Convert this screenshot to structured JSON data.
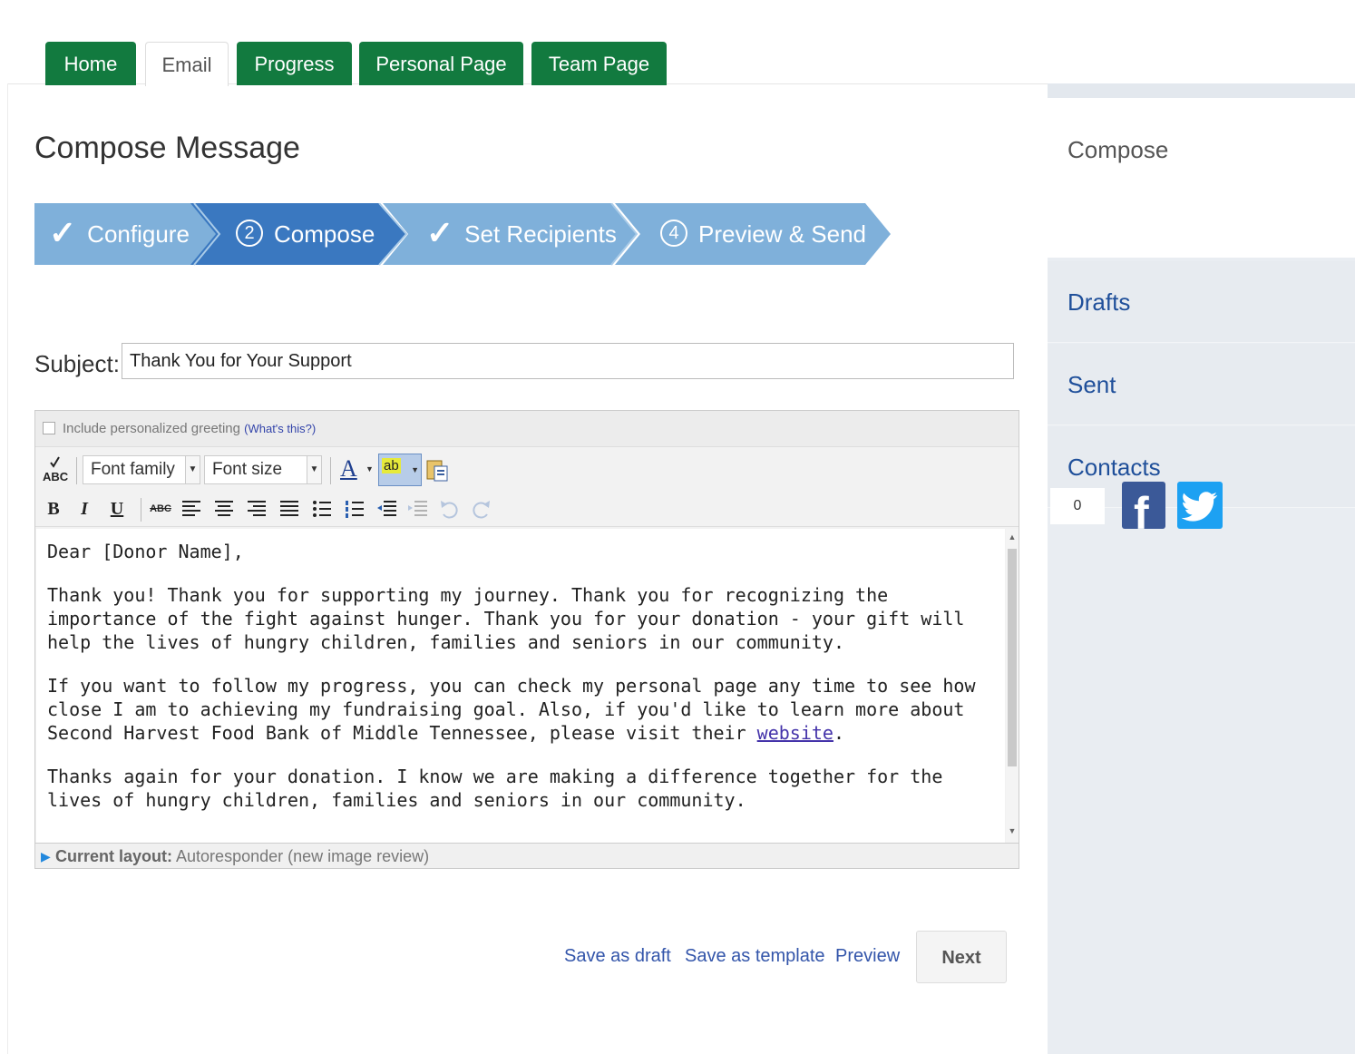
{
  "tabs": [
    {
      "label": "Home",
      "state": "inactive"
    },
    {
      "label": "Email",
      "state": "active"
    },
    {
      "label": "Progress",
      "state": "inactive"
    },
    {
      "label": "Personal Page",
      "state": "inactive"
    },
    {
      "label": "Team Page",
      "state": "inactive"
    }
  ],
  "page_title": "Compose Message",
  "steps": [
    {
      "number": "✓",
      "label": "Configure",
      "state": "done"
    },
    {
      "number": "2",
      "label": "Compose",
      "state": "current"
    },
    {
      "number": "✓",
      "label": "Set Recipients",
      "state": "done"
    },
    {
      "number": "4",
      "label": "Preview & Send",
      "state": "todo"
    }
  ],
  "subject": {
    "label": "Subject:",
    "value": "Thank You for Your Support"
  },
  "editor": {
    "greeting_label": "Include personalized greeting",
    "greeting_link": "(What's this?)",
    "font_family": "Font family",
    "font_size": "Font size",
    "spellcheck_label": "ABC",
    "bold": "B",
    "italic": "I",
    "underline": "U",
    "strike": "ABC",
    "text_color_glyph": "A",
    "highlight_glyph": "ab",
    "body": {
      "salutation": "Dear [Donor Name],",
      "p1": "Thank you! Thank you for supporting my journey. Thank you for recognizing the importance of the fight against hunger. Thank you for your donation - your gift will help the lives of hungry children, families and seniors in our community.",
      "p2_before": "If you want to follow my progress, you can check my personal page any time to see how close I am to achieving my fundraising goal. Also, if you'd like to learn more about Second Harvest Food Bank of Middle Tennessee, please visit their ",
      "p2_link": "website",
      "p2_after": ".",
      "p3": "Thanks again for your donation. I know we are making a difference together for the lives of hungry children, families and seniors in our community."
    },
    "layout_label": "Current layout:",
    "layout_value": "Autoresponder (new image review)"
  },
  "actions": {
    "save_draft": "Save as draft",
    "save_template": "Save as template",
    "preview": "Preview",
    "next": "Next"
  },
  "sidebar": {
    "compose": "Compose",
    "items": [
      "Drafts",
      "Sent",
      "Contacts"
    ]
  },
  "social": {
    "count": "0",
    "facebook_glyph": "f"
  },
  "colors": {
    "tab_green": "#127a3f",
    "step_light": "#7fb0da",
    "step_dark": "#3a78c0",
    "link_blue": "#3355aa"
  }
}
